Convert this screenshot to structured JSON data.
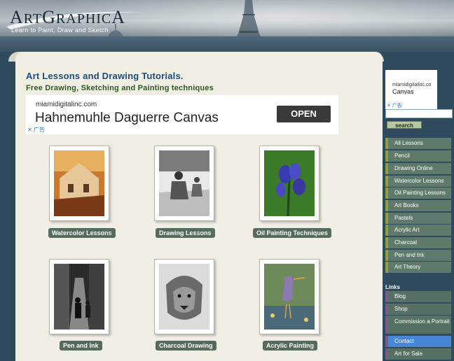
{
  "header": {
    "logo_part1": "A",
    "logo_part2": "RT",
    "logo_part3": "G",
    "logo_part4": "RAPHIC",
    "logo_part5": "A",
    "tagline": "Learn to Paint, Draw and Sketch"
  },
  "main": {
    "heading": "Art Lessons and Drawing Tutorials.",
    "subheading": "Free Drawing, Sketching and Painting techniques"
  },
  "ad": {
    "domain": "miamidigitalinc.com",
    "title": "Hahnemuhle Daguerre Canvas",
    "button": "OPEN",
    "mark": "✕ 广告"
  },
  "gallery": {
    "items": [
      {
        "label": "Watercolor Lessons"
      },
      {
        "label": "Drawing Lessons"
      },
      {
        "label": "Oil Painting Techniques"
      },
      {
        "label": "Pen and Ink"
      },
      {
        "label": "Charcoal Drawing"
      },
      {
        "label": "Acrylic Painting"
      }
    ]
  },
  "sidebar": {
    "ad_domain": "miamidigitalinc.co",
    "ad_title": "Canvas",
    "ad_mark": "✕ 广告",
    "search_button": "search",
    "nav": [
      "All Lessons",
      "Pencil",
      "Drawing Online",
      "Watercolor Lessons",
      "Oil Painting Lessons",
      "Art Books",
      "Pastels",
      "Acrylic Art",
      "Charcoal",
      "Pen and Ink",
      "Art Theory"
    ],
    "links_label": "Links",
    "links": [
      "Blog",
      "Shop",
      "Commission a Portrait",
      "Contact",
      "Art for Sale"
    ]
  },
  "colors": {
    "heading": "#1f4d78",
    "subheading": "#2d5a1e",
    "caption_bg": "#556b5e",
    "sidebar_bg": "#2f4a5c",
    "active_link": "#4a86d8"
  }
}
